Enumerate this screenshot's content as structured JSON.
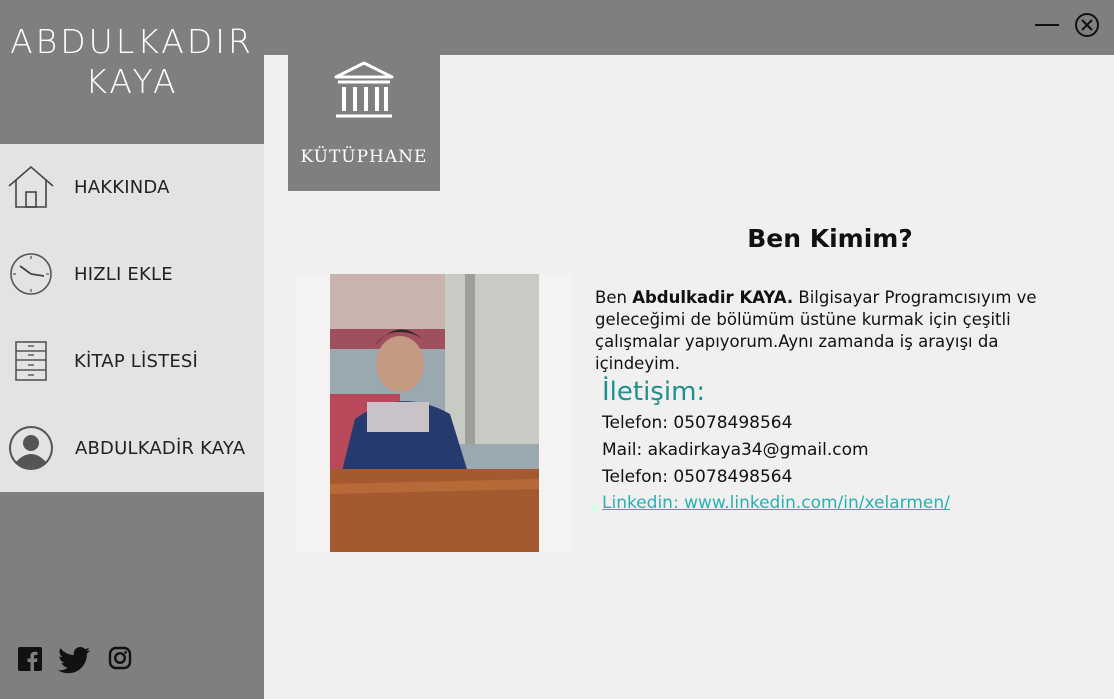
{
  "app": {
    "title_line1": "ABDULKADIR",
    "title_line2": "KAYA"
  },
  "window_controls": [
    {
      "name": "minimize-icon"
    },
    {
      "name": "close-icon"
    }
  ],
  "nav": {
    "items": [
      {
        "label": "HAKKINDA",
        "icon": "home-icon"
      },
      {
        "label": "HIZLI EKLE",
        "icon": "clock-icon"
      },
      {
        "label": "KİTAP LİSTESİ",
        "icon": "book-list-icon"
      },
      {
        "label": "ABDULKADİR KAYA",
        "icon": "user-avatar-icon"
      }
    ]
  },
  "social": [
    "facebook-icon",
    "twitter-icon",
    "instagram-icon"
  ],
  "header_tile": {
    "label": "KÜTÜPHANE",
    "icon": "library-icon"
  },
  "about": {
    "heading": "Ben Kimim?",
    "bio_prefix": "Ben ",
    "bio_name": "Abdulkadir KAYA.",
    "bio_text": " Bilgisayar Programcısıyım ve geleceğimi de bölümüm üstüne kurmak için çeşitli çalışmalar yapıyorum.Aynı zamanda iş arayışı da içindeyim."
  },
  "contact": {
    "title": "İletişim:",
    "lines": [
      "Telefon: 05078498564",
      "Mail: akadirkaya34@gmail.com",
      "Telefon: 05078498564"
    ],
    "link": "Linkedin: www.linkedin.com/in/xelarmen/"
  },
  "colors": {
    "sidebar": "#7f7f7f",
    "nav_bg": "#e3e3e3",
    "content_bg": "#f0f0f0",
    "accent": "#1f8f8f",
    "link": "#2ab0b0"
  }
}
